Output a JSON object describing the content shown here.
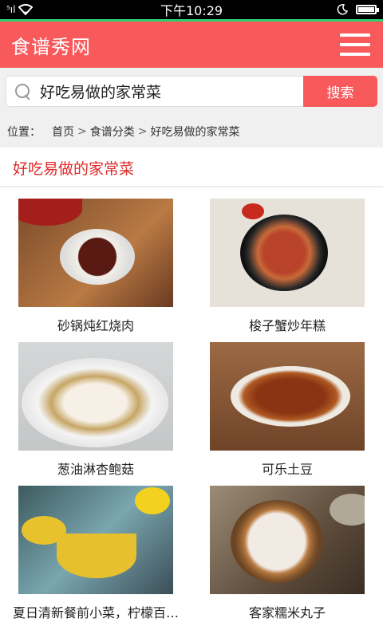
{
  "status_bar": {
    "signal_text": "⁵ıl",
    "time": "下午10:29"
  },
  "header": {
    "title": "食谱秀网"
  },
  "search": {
    "value": "好吃易做的家常菜",
    "button_label": "搜索"
  },
  "breadcrumb": {
    "prefix": "位置：",
    "items": [
      "首页",
      "食谱分类",
      "好吃易做的家常菜"
    ],
    "separator": ">"
  },
  "section": {
    "title": "好吃易做的家常菜"
  },
  "recipes": [
    {
      "name": "砂锅炖红烧肉"
    },
    {
      "name": "梭子蟹炒年糕"
    },
    {
      "name": "葱油淋杏鲍菇"
    },
    {
      "name": "可乐土豆"
    },
    {
      "name": "夏日清新餐前小菜，柠檬百…"
    },
    {
      "name": "客家糯米丸子"
    }
  ],
  "colors": {
    "brand": "#f85a5c",
    "section_title": "#e02a2a",
    "status_accent": "#2ed06a"
  },
  "icons": [
    "sim-icon",
    "wifi-icon",
    "moon-icon",
    "battery-icon",
    "menu-icon",
    "search-icon"
  ]
}
